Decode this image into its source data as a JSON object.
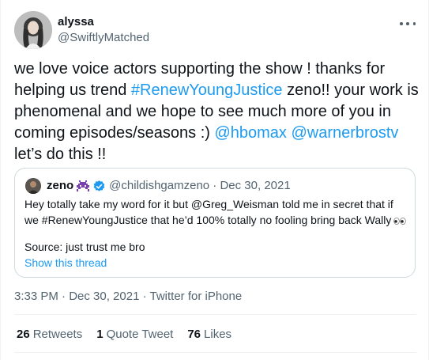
{
  "tweet": {
    "author": {
      "display_name": "alyssa",
      "handle": "@SwiftlyMatched",
      "avatar_icon": "profile-photo"
    },
    "text_parts": [
      {
        "text": "we love voice actors supporting the show ! thanks for helping us trend ",
        "link": false
      },
      {
        "text": "#RenewYoungJustice",
        "link": true
      },
      {
        "text": " zeno!! your work is phenomenal and we hope to see much more of you in coming episodes/seasons :) ",
        "link": false
      },
      {
        "text": "@hbomax",
        "link": true
      },
      {
        "text": " ",
        "link": false
      },
      {
        "text": "@warnerbrostv",
        "link": true
      },
      {
        "text": " let’s do this !!",
        "link": false
      }
    ],
    "more_icon": "more-horizontal-icon",
    "timestamp": "3:33 PM · Dec 30, 2021 · ",
    "source": "Twitter for iPhone",
    "stats": {
      "retweets_count": "26",
      "retweets_label": "Retweets",
      "quotes_count": "1",
      "quotes_label": "Quote Tweet",
      "likes_count": "76",
      "likes_label": "Likes"
    }
  },
  "quoted": {
    "display_name": "zeno",
    "handle_date": "@childishgamzeno · Dec 30, 2021",
    "text": "Hey totally take my word for it but @Greg_Weisman told me in secret that if we #RenewYoungJustice that he’d 100% totally no fooling bring back Wally",
    "eyes_emoji": "👀",
    "source_line": "Source: just trust me bro",
    "show_thread": "Show this thread",
    "verified_icon": "verified-badge-icon",
    "emoji_icon": "alien-monster-icon"
  },
  "colors": {
    "link": "#1d9bf0",
    "text": "#0f1419",
    "secondary": "#536471",
    "border": "#cfd9de"
  }
}
